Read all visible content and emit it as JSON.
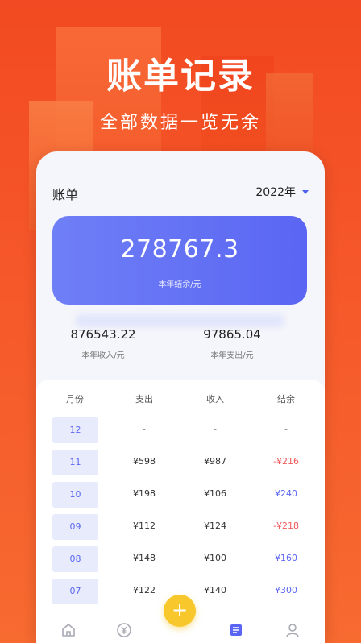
{
  "promo": {
    "title": "账单记录",
    "subtitle": "全部数据一览无余"
  },
  "header": {
    "title": "账单",
    "year": "2022年"
  },
  "balance": {
    "value": "278767.3",
    "label": "本年结余/元"
  },
  "stats": {
    "income": {
      "value": "876543.22",
      "label": "本年收入/元"
    },
    "expense": {
      "value": "97865.04",
      "label": "本年支出/元"
    }
  },
  "table": {
    "headers": [
      "月份",
      "支出",
      "收入",
      "结余"
    ],
    "rows": [
      {
        "month": "12",
        "expense": "-",
        "income": "-",
        "balance": "-",
        "balance_color": "#333333"
      },
      {
        "month": "11",
        "expense": "¥598",
        "income": "¥987",
        "balance": "-¥216",
        "balance_color": "#f15a5a"
      },
      {
        "month": "10",
        "expense": "¥198",
        "income": "¥106",
        "balance": "¥240",
        "balance_color": "#5a66f3"
      },
      {
        "month": "09",
        "expense": "¥112",
        "income": "¥124",
        "balance": "-¥218",
        "balance_color": "#f15a5a"
      },
      {
        "month": "08",
        "expense": "¥148",
        "income": "¥100",
        "balance": "¥160",
        "balance_color": "#5a66f3"
      },
      {
        "month": "07",
        "expense": "¥122",
        "income": "¥140",
        "balance": "¥300",
        "balance_color": "#5a66f3"
      }
    ]
  },
  "tabbar": {
    "items": [
      "home-icon",
      "yuan-icon",
      "bill-icon",
      "profile-icon"
    ],
    "active_color": "#5a66f3",
    "inactive_color": "#a9a9b3",
    "add_label": "+"
  }
}
